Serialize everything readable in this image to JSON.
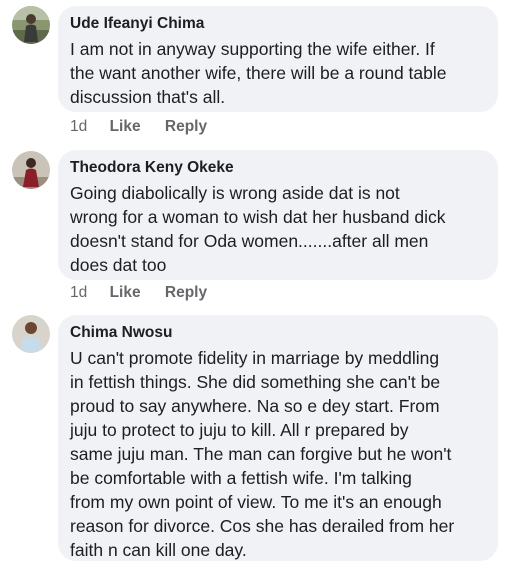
{
  "comments": [
    {
      "author": "Ude Ifeanyi Chima",
      "text": "I am not in anyway supporting the wife either. If\nthe want another wife, there will be a round table\ndiscussion that's all.",
      "time": "1d",
      "like_label": "Like",
      "reply_label": "Reply"
    },
    {
      "author": "Theodora Keny Okeke",
      "text": "Going diabolically is wrong aside dat  is not\nwrong for a woman to wish dat her husband dick\ndoesn't stand for Oda women.......after all men\ndoes dat too",
      "time": "1d",
      "like_label": "Like",
      "reply_label": "Reply"
    },
    {
      "author": "Chima Nwosu",
      "text": "U can't promote fidelity in marriage by meddling\nin fettish things. She did something she can't be\nproud to say anywhere. Na so e dey start. From\njuju to protect to juju to kill. All r prepared by\nsame juju man. The man can forgive but he won't\nbe comfortable with a fettish wife. I'm talking\nfrom my own point of view. To me it's an enough\nreason for divorce. Cos she has derailed from her\nfaith n can kill one day."
    }
  ],
  "colors": {
    "bubble_bg": "#f0f2f5",
    "text": "#1c1e21",
    "meta": "#65676b"
  }
}
